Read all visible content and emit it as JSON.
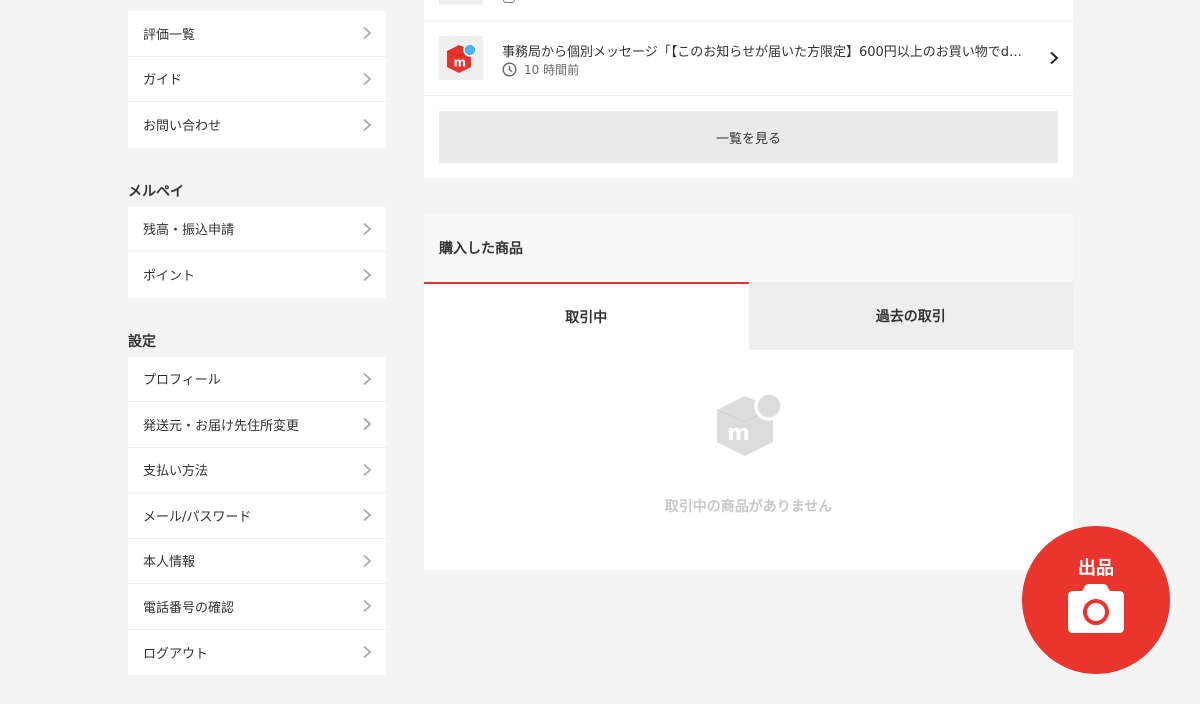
{
  "sidebar": {
    "top_items": [
      {
        "label": "評価一覧"
      },
      {
        "label": "ガイド"
      },
      {
        "label": "お問い合わせ"
      }
    ],
    "merpay": {
      "title": "メルペイ",
      "items": [
        {
          "label": "残高・振込申請"
        },
        {
          "label": "ポイント"
        }
      ]
    },
    "settings": {
      "title": "設定",
      "items": [
        {
          "label": "プロフィール"
        },
        {
          "label": "発送元・お届け先住所変更"
        },
        {
          "label": "支払い方法"
        },
        {
          "label": "メール/パスワード"
        },
        {
          "label": "本人情報"
        },
        {
          "label": "電話番号の確認"
        },
        {
          "label": "ログアウト"
        }
      ]
    }
  },
  "notifications": {
    "item": {
      "text": "事務局から個別メッセージ「【このお知らせが届いた方限定】600円以上のお買い物でd…",
      "time": "10 時間前",
      "icon": "mercari-logo-icon"
    },
    "see_all_label": "一覧を見る"
  },
  "purchases": {
    "title": "購入した商品",
    "tabs": [
      {
        "label": "取引中",
        "active": true
      },
      {
        "label": "過去の取引",
        "active": false
      }
    ],
    "empty_text": "取引中の商品がありません"
  },
  "sell_button": {
    "label": "出品",
    "icon": "camera-icon"
  },
  "colors": {
    "accent": "#ea352d",
    "background": "#f4f4f4"
  }
}
